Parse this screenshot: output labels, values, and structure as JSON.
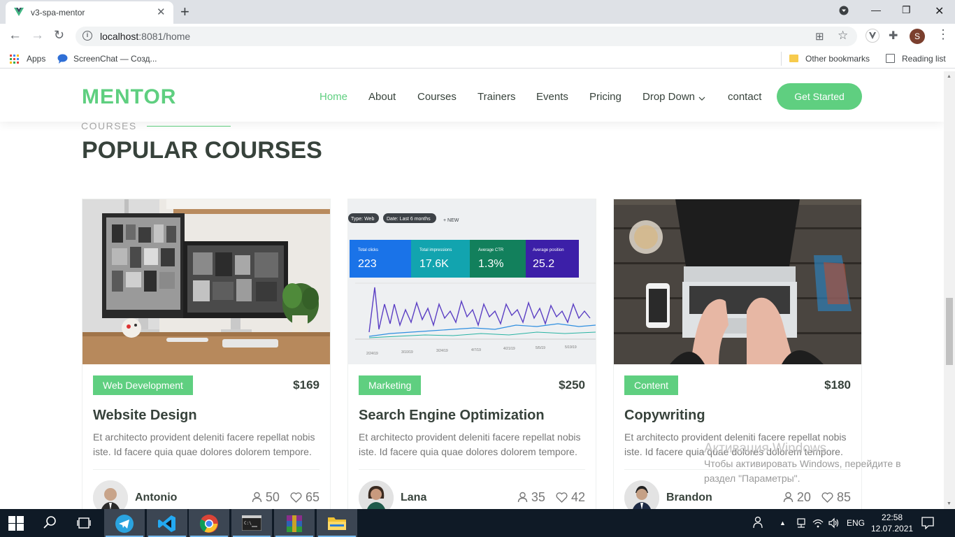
{
  "browser": {
    "tab_title": "v3-spa-mentor",
    "url_host": "localhost",
    "url_rest": ":8081/home",
    "bookmarks": [
      "Apps",
      "ScreenChat — Созд...",
      "Other bookmarks",
      "Reading list"
    ]
  },
  "header": {
    "logo": "MENTOR",
    "nav": [
      "Home",
      "About",
      "Courses",
      "Trainers",
      "Events",
      "Pricing",
      "Drop Down",
      "contact"
    ],
    "cta": "Get Started"
  },
  "section": {
    "eyebrow": "COURSES",
    "title": "POPULAR COURSES"
  },
  "courses": [
    {
      "category": "Web Development",
      "price": "$169",
      "title": "Website Design",
      "desc": "Et architecto provident deleniti facere repellat nobis iste. Id facere quia quae dolores dolorem tempore.",
      "trainer": "Antonio",
      "students": "50",
      "likes": "65"
    },
    {
      "category": "Marketing",
      "price": "$250",
      "title": "Search Engine Optimization",
      "desc": "Et architecto provident deleniti facere repellat nobis iste. Id facere quia quae dolores dolorem tempore.",
      "trainer": "Lana",
      "students": "35",
      "likes": "42"
    },
    {
      "category": "Content",
      "price": "$180",
      "title": "Copywriting",
      "desc": "Et architecto provident deleniti facere repellat nobis iste. Id facere quia quae dolores dolorem tempore.",
      "trainer": "Brandon",
      "students": "20",
      "likes": "85"
    }
  ],
  "dashboard_image": {
    "filter_chip": "Type: Web",
    "date_chip": "Date: Last 6 months",
    "new_label": "+ NEW",
    "tiles": [
      {
        "label": "Total clicks",
        "value": "223"
      },
      {
        "label": "Total impressions",
        "value": "17.6K"
      },
      {
        "label": "Average CTR",
        "value": "1.3%"
      },
      {
        "label": "Average position",
        "value": "25.2"
      }
    ],
    "dates": [
      "2/24/19",
      "3/10/19",
      "3/24/19",
      "4/7/19",
      "4/21/19",
      "5/5/19",
      "5/19/19"
    ]
  },
  "watermark": {
    "line1": "Активация Windows",
    "line2": "Чтобы активировать Windows, перейдите в",
    "line3": "раздел \"Параметры\"."
  },
  "taskbar": {
    "lang": "ENG",
    "time": "22:58",
    "date": "12.07.2021"
  },
  "colors": {
    "accent": "#5fcf80",
    "heading": "#37423b",
    "text": "#777777"
  }
}
